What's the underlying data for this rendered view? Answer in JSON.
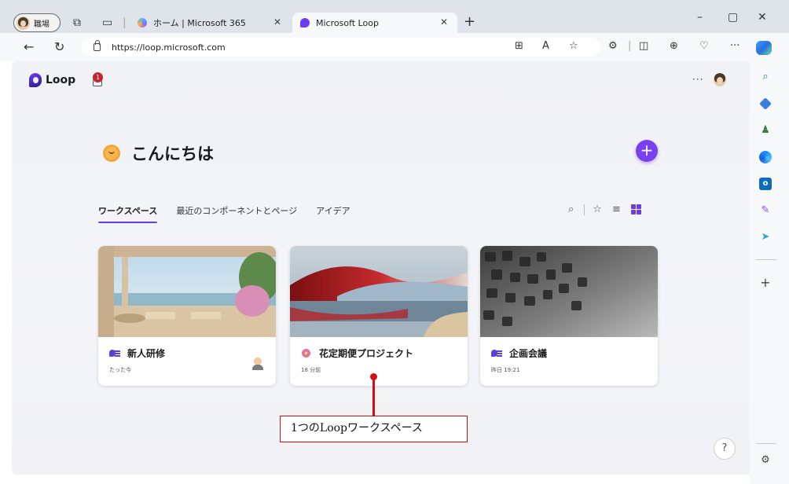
{
  "browser": {
    "profile_label": "職場",
    "tabs": [
      {
        "title": "ホーム | Microsoft 365",
        "active": false
      },
      {
        "title": "Microsoft Loop",
        "active": true
      }
    ],
    "url": "https://loop.microsoft.com",
    "new_tab_glyph": "+",
    "close_glyph": "✕"
  },
  "loop": {
    "app_name": "Loop",
    "notification_count": "1",
    "greeting": "こんにちは",
    "add_glyph": "+",
    "tabs": [
      "ワークスペース",
      "最近のコンポーネントとページ",
      "アイデア"
    ],
    "active_tab_index": 0,
    "help_glyph": "?",
    "workspaces": [
      {
        "title": "新人研修",
        "time": "たった今",
        "icon": "workspace-icon"
      },
      {
        "title": "花定期便プロジェクト",
        "time": "18 分前",
        "icon": "flower-icon"
      },
      {
        "title": "企画会議",
        "time": "昨日 19:21",
        "icon": "workspace-icon"
      }
    ]
  },
  "annotation": {
    "label": "1つのLoopワークスペース"
  },
  "colors": {
    "accent": "#7b3ff2",
    "annotation": "#d01010"
  }
}
